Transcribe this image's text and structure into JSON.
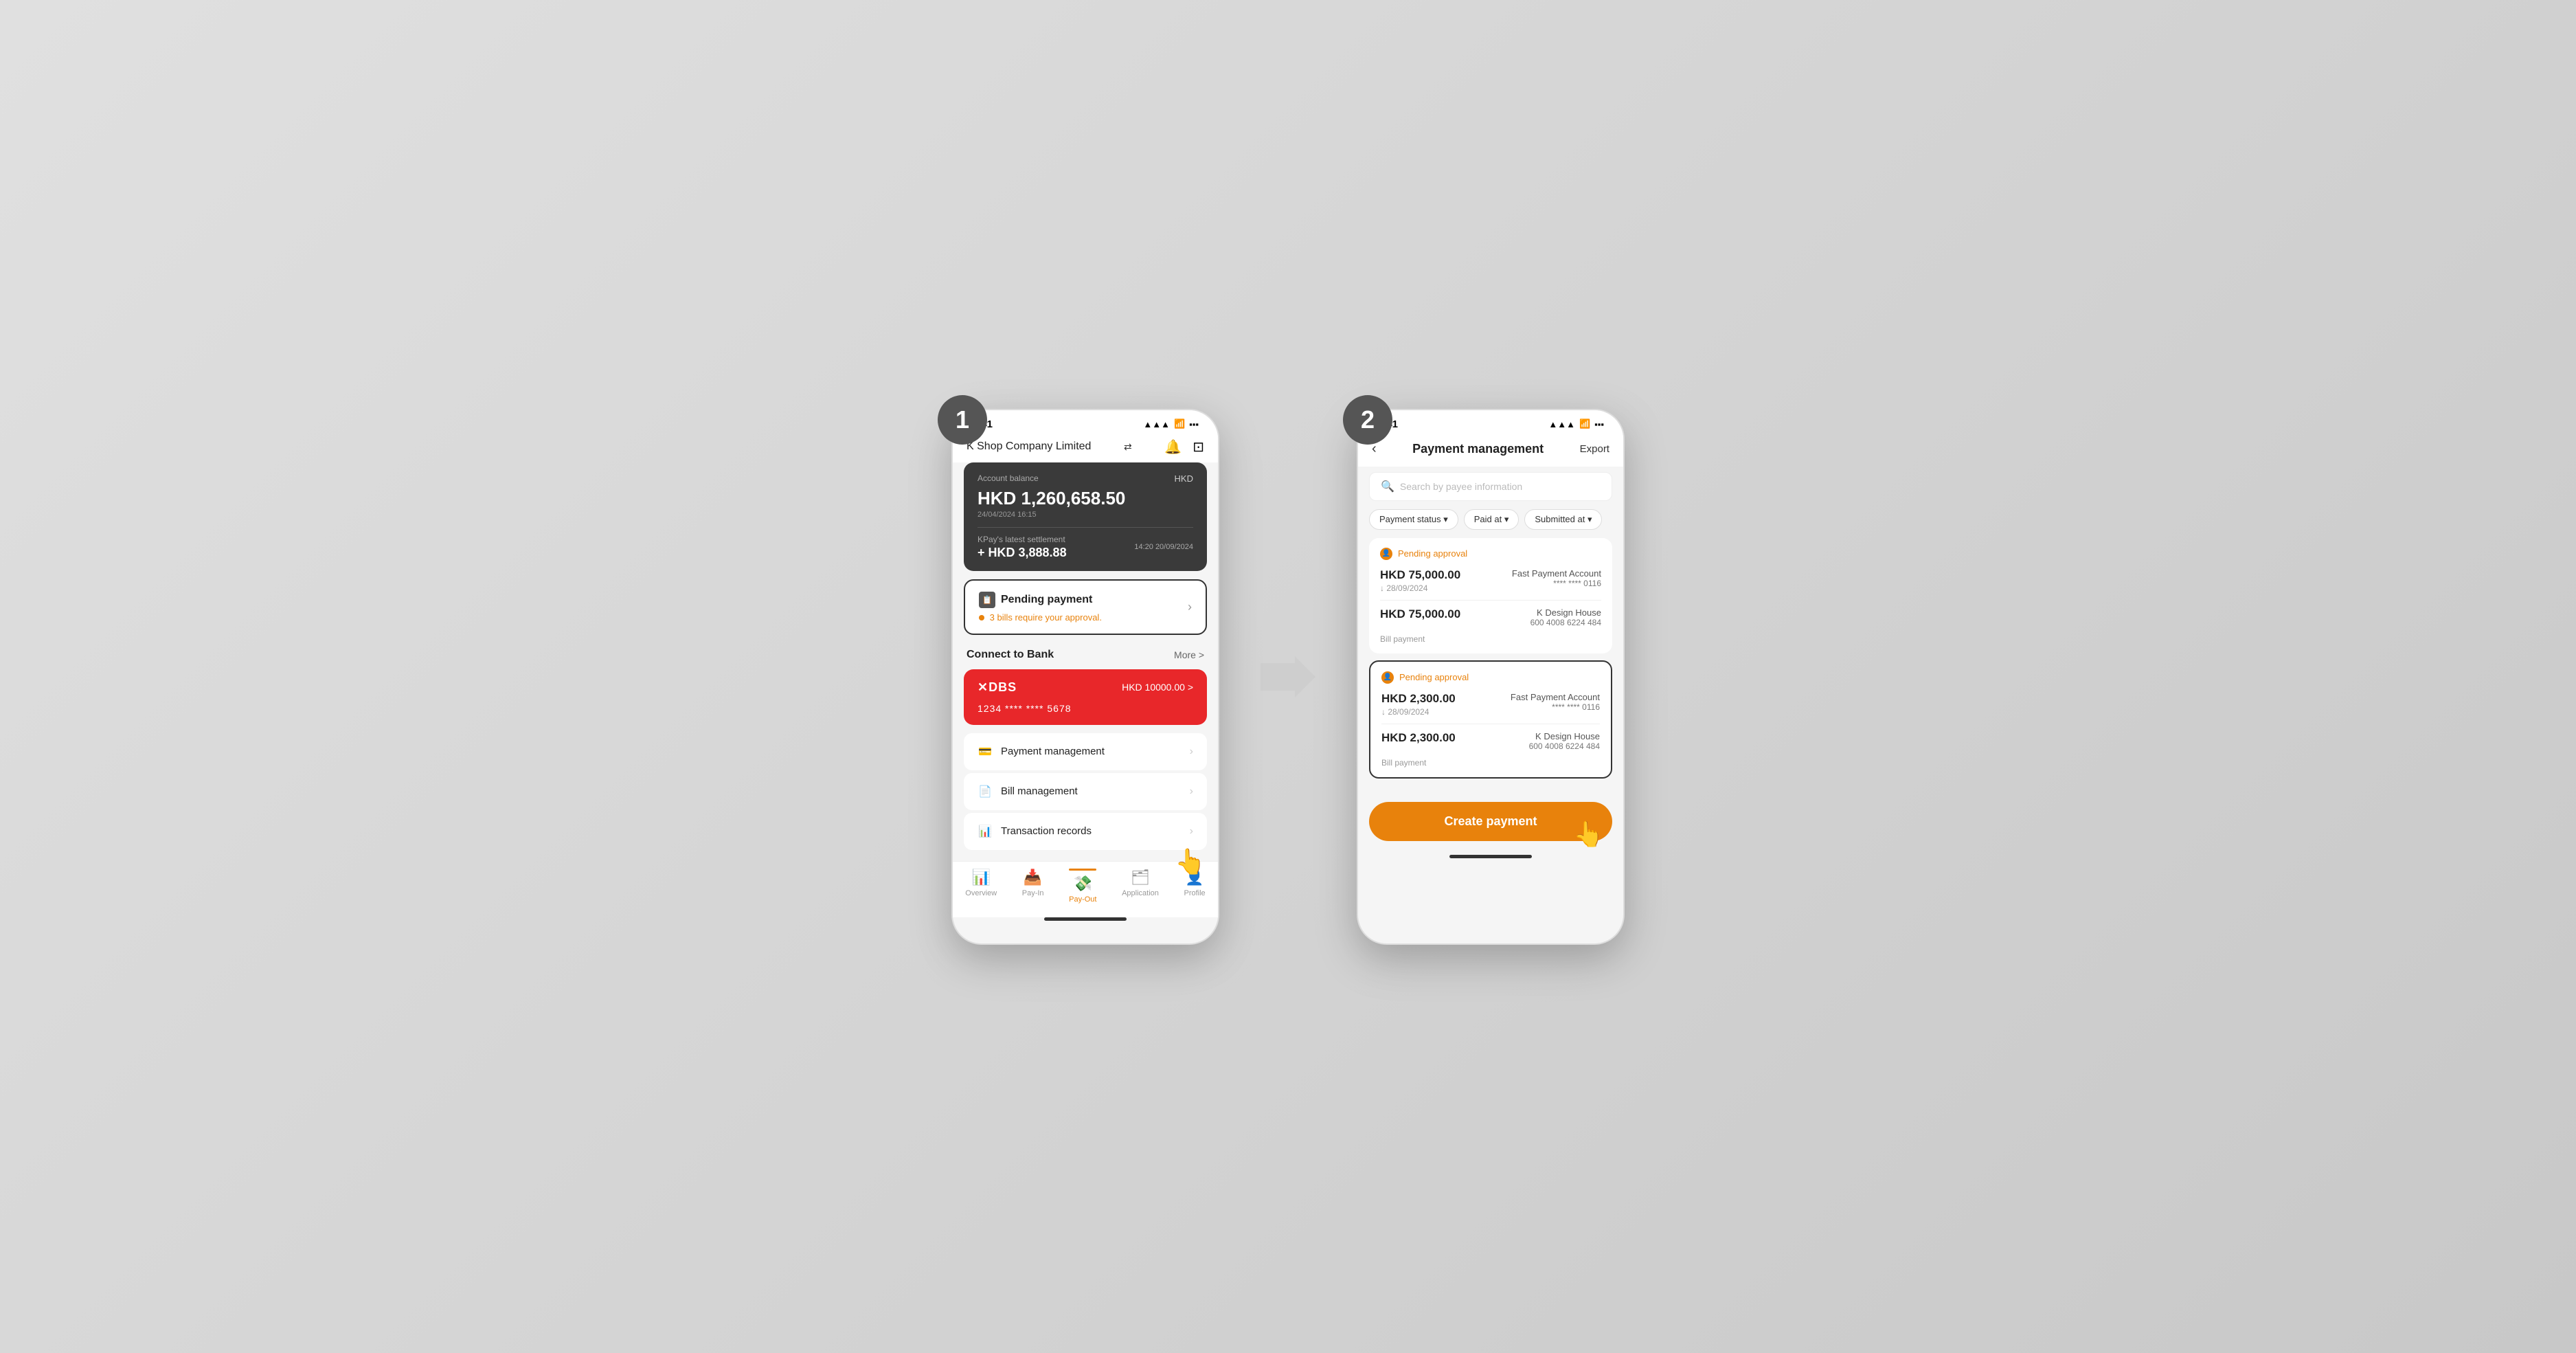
{
  "scene": {
    "bg_color": "#d0d0d0"
  },
  "phone1": {
    "step": "1",
    "status_bar": {
      "time": "9:41",
      "signal": "▲▲▲",
      "wifi": "wifi",
      "battery": "battery"
    },
    "header": {
      "company": "K Shop Company Limited",
      "exchange_icon": "⇄"
    },
    "account_card": {
      "label": "Account balance",
      "currency": "HKD",
      "balance": "HKD 1,260,658.50",
      "date": "24/04/2024 16:15",
      "settlement_label": "KPay's latest settlement",
      "settlement_time": "14:20 20/09/2024",
      "settlement_amount": "+ HKD 3,888.88"
    },
    "pending_payment": {
      "title": "Pending payment",
      "subtitle": "3 bills require your approval."
    },
    "connect_bank": {
      "title": "Connect to Bank",
      "more": "More >"
    },
    "dbs_card": {
      "logo": "✕DBS",
      "amount": "HKD 10000.00 >",
      "account": "1234 **** **** 5678"
    },
    "menu_items": [
      {
        "icon": "💳",
        "label": "Payment management"
      },
      {
        "icon": "📄",
        "label": "Bill management"
      },
      {
        "icon": "📊",
        "label": "Transaction records"
      }
    ],
    "bottom_nav": [
      {
        "icon": "📊",
        "label": "Overview",
        "active": false
      },
      {
        "icon": "📥",
        "label": "Pay-In",
        "active": false
      },
      {
        "icon": "💸",
        "label": "Pay-Out",
        "active": true
      },
      {
        "icon": "🗂",
        "label": "Application",
        "active": false
      },
      {
        "icon": "👤",
        "label": "Profile",
        "active": false
      }
    ]
  },
  "phone2": {
    "step": "2",
    "status_bar": {
      "time": "9:41"
    },
    "header": {
      "back": "‹",
      "title": "Payment management",
      "export": "Export"
    },
    "search": {
      "placeholder": "Search by payee information"
    },
    "filters": [
      {
        "label": "Payment status ▾"
      },
      {
        "label": "Paid at ▾"
      },
      {
        "label": "Submitted at ▾"
      }
    ],
    "payment_cards": [
      {
        "status": "Pending approval",
        "amount1": "HKD 75,000.00",
        "payee1": "Fast Payment Account",
        "acct1": "**** **** 0116",
        "date1": "↓ 28/09/2024",
        "amount2": "HKD 75,000.00",
        "payee2": "K Design House",
        "acct2": "600 4008 6224 484",
        "bill_tag": "Bill payment",
        "active": false
      },
      {
        "status": "Pending approval",
        "amount1": "HKD 2,300.00",
        "payee1": "Fast Payment Account",
        "acct1": "**** **** 0116",
        "date1": "↓ 28/09/2024",
        "amount2": "HKD 2,300.00",
        "payee2": "K Design House",
        "acct2": "600 4008 6224 484",
        "bill_tag": "Bill payment",
        "active": true
      }
    ],
    "create_button": "Create payment"
  }
}
